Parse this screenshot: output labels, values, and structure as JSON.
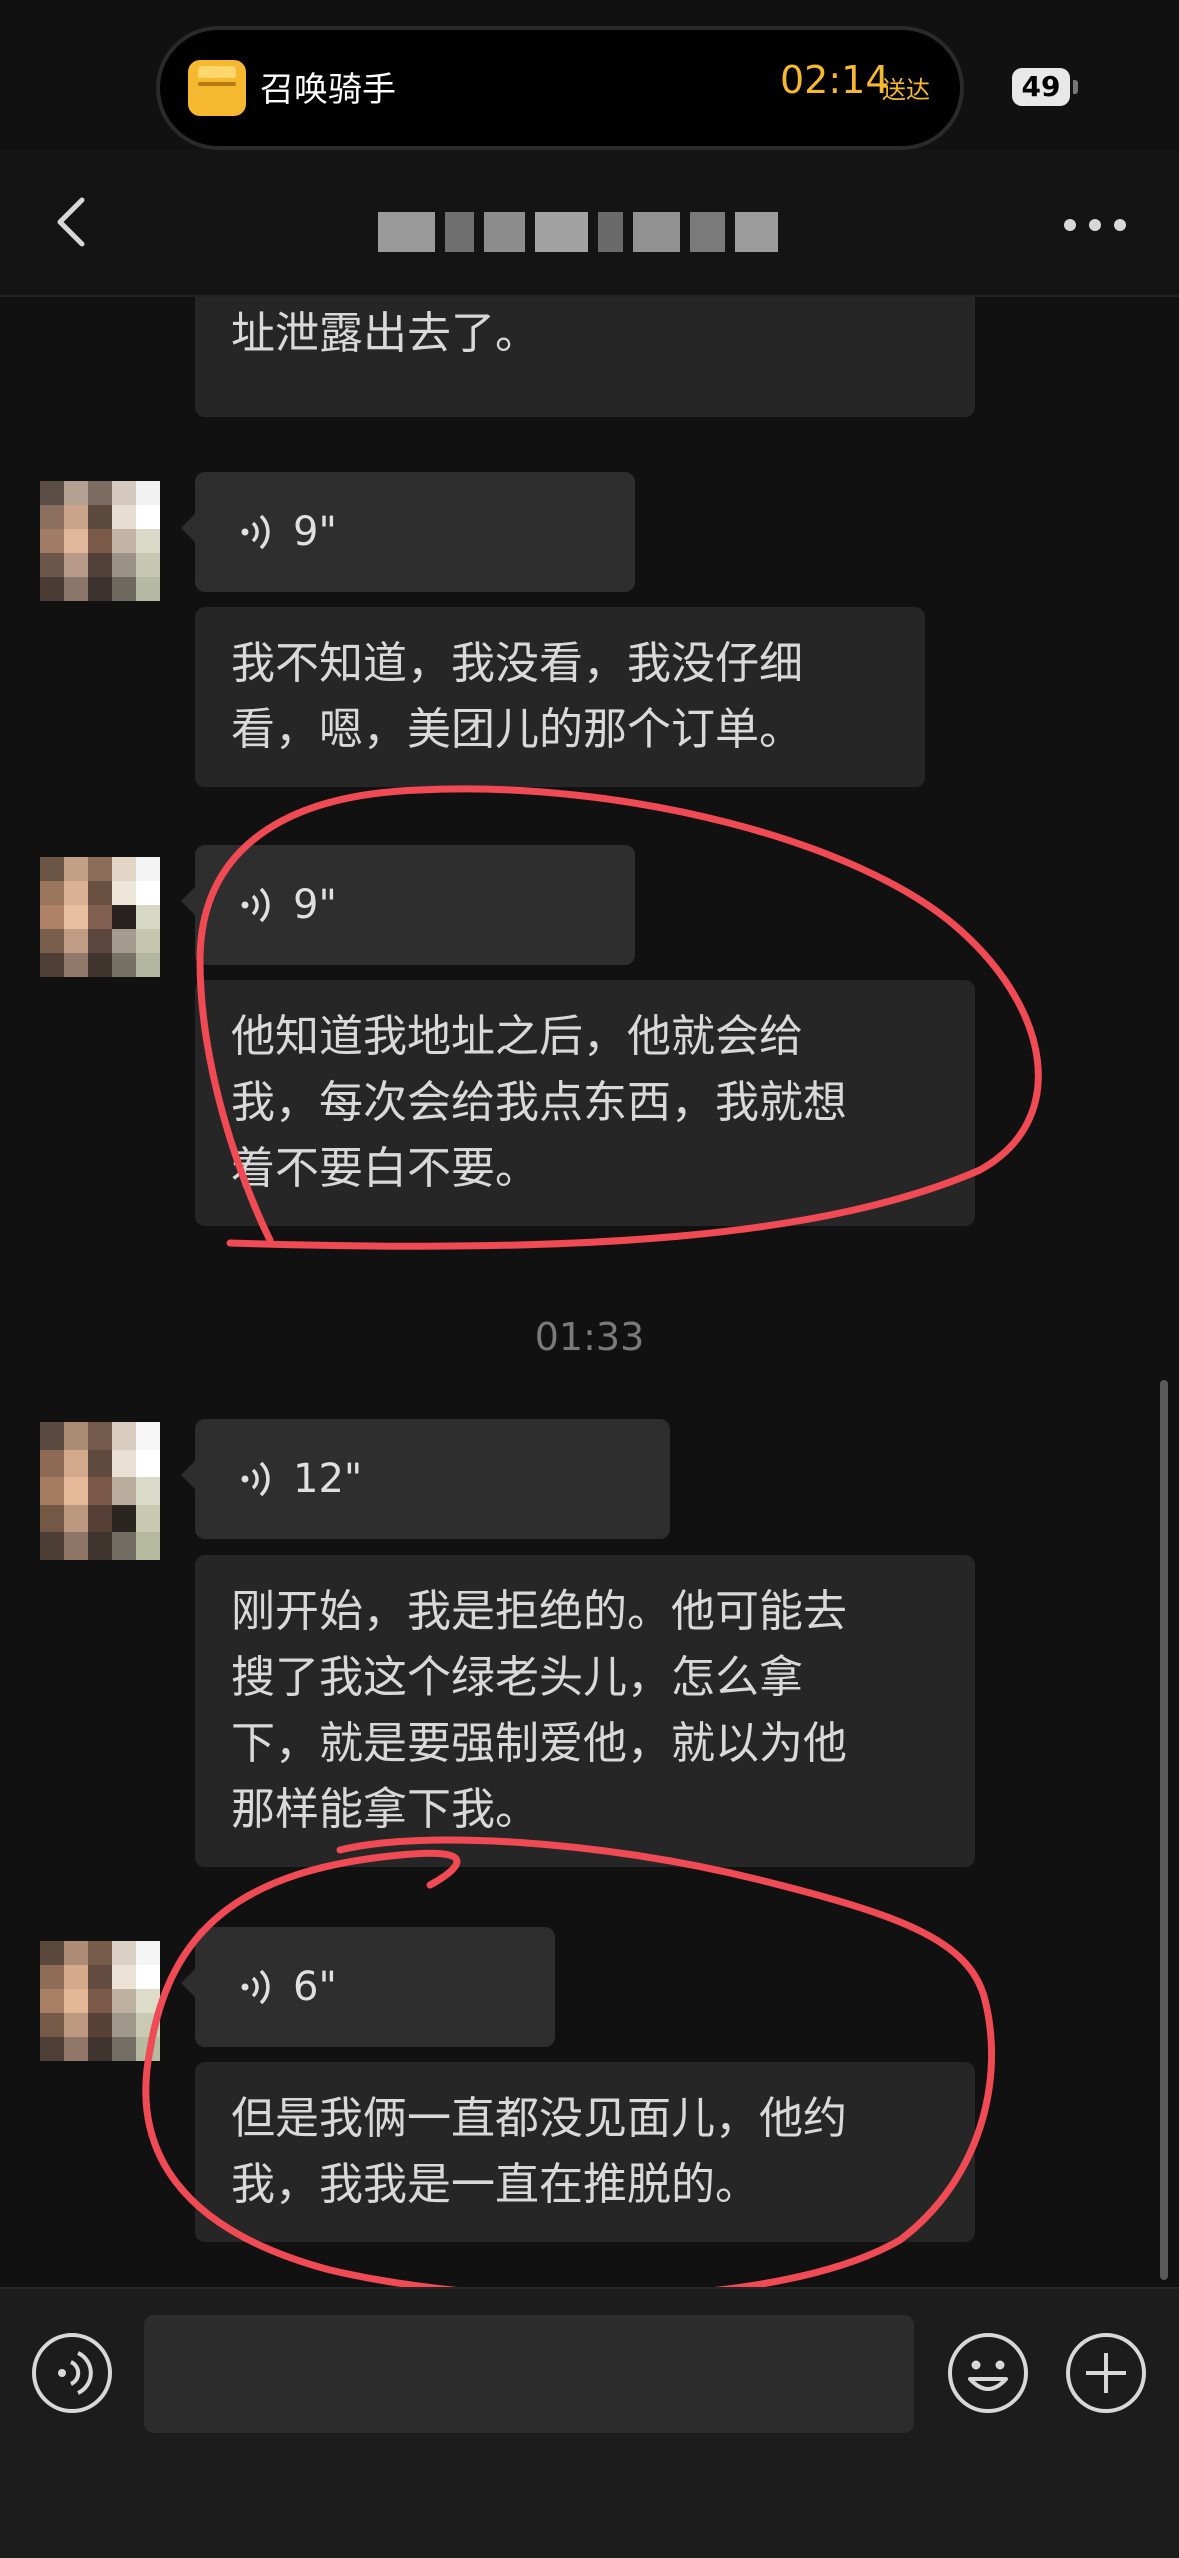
{
  "status": {
    "activity_title": "召唤骑手",
    "activity_time": "02:14",
    "activity_suffix": "送达",
    "battery": "49",
    "accent": "#f5b82e"
  },
  "chat": {
    "partial_message": "中间聊天儿，我不小心把我的地址泄露出去了。",
    "partial_message_line2": "址泄露出去了。",
    "messages": [
      {
        "voice_duration": "9\"",
        "transcript_lines": [
          "我不知道，我没看，我没仔细",
          "看，嗯，美团儿的那个订单。"
        ]
      },
      {
        "voice_duration": "9\"",
        "transcript_lines": [
          "他知道我地址之后，他就会给",
          "我，每次会给我点东西，我就想",
          "着不要白不要。"
        ]
      },
      {
        "voice_duration": "12\"",
        "transcript_lines": [
          "刚开始，我是拒绝的。他可能去",
          "搜了我这个绿老头儿，怎么拿",
          "下，就是要强制爱他，就以为他",
          "那样能拿下我。"
        ]
      },
      {
        "voice_duration": "6\"",
        "transcript_lines": [
          "但是我俩一直都没见面儿，他约",
          "我，我我是一直在推脱的。"
        ]
      }
    ],
    "timestamp": "01:33"
  },
  "input": {
    "placeholder": ""
  },
  "icons": {
    "back": "chevron-left-icon",
    "more": "more-dots-icon",
    "voice": "voice-wave-icon",
    "emoji": "emoji-icon",
    "plus": "plus-icon"
  },
  "colors": {
    "annotation": "#f04a55",
    "background": "#111111",
    "bubble": "#2b2b2b"
  }
}
